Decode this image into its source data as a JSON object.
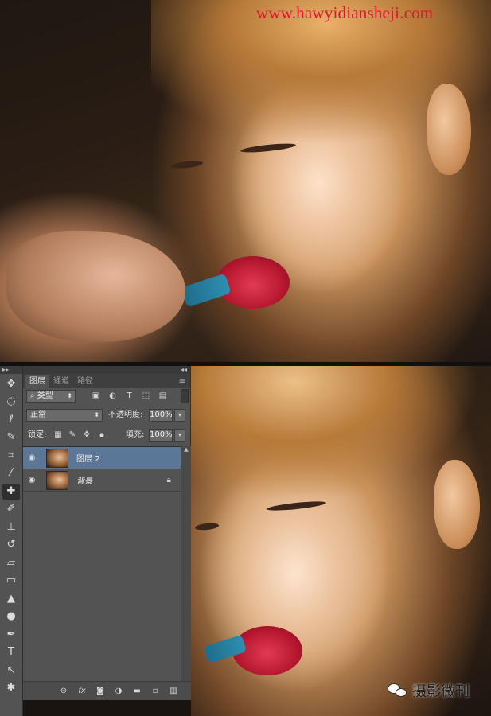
{
  "watermark": "www.hawyidiansheji.com",
  "layers_panel": {
    "tabs": [
      "图层",
      "通道",
      "路径"
    ],
    "active_tab": 0,
    "filter_kind": "类型",
    "blend_mode": "正常",
    "opacity_label": "不透明度:",
    "opacity_value": "100%",
    "lock_label": "锁定:",
    "fill_label": "填充:",
    "fill_value": "100%",
    "layers": [
      {
        "name": "图层 2",
        "visible": true,
        "selected": true,
        "locked": false
      },
      {
        "name": "背景",
        "visible": true,
        "selected": false,
        "locked": true
      }
    ]
  },
  "tools": [
    "move-tool",
    "marquee-tool",
    "lasso-tool",
    "quick-select-tool",
    "crop-tool",
    "eyedropper-tool",
    "healing-brush-tool",
    "brush-tool",
    "clone-stamp-tool",
    "history-brush-tool",
    "eraser-tool",
    "gradient-tool",
    "blur-tool",
    "dodge-tool",
    "pen-tool",
    "type-tool",
    "path-select-tool",
    "shape-tool"
  ],
  "active_tool": "healing-brush-tool",
  "colors": {
    "panel_bg": "#535353",
    "selection": "#5b7696",
    "watermark": "#e0152e",
    "lips": "#c41a38"
  },
  "wechat": {
    "icon": "wechat-icon",
    "name": "摄影微刊"
  }
}
